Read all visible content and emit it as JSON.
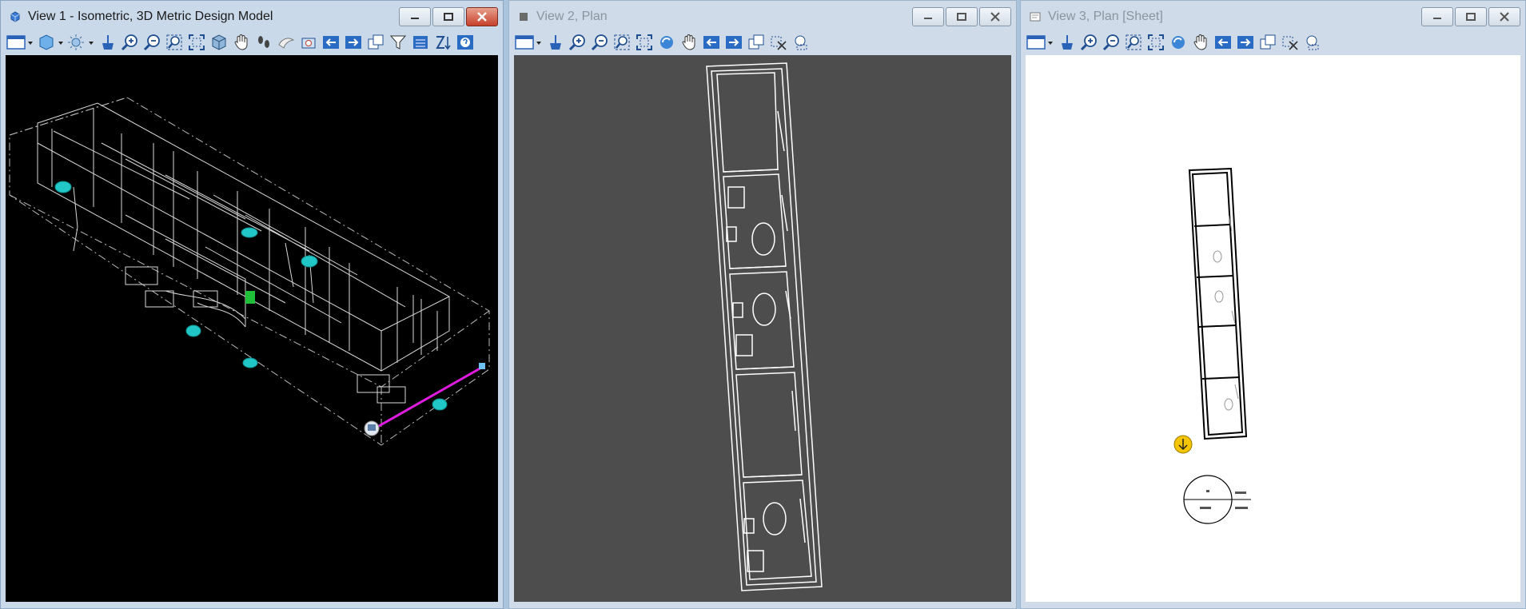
{
  "windows": [
    {
      "title": "View 1 - Isometric, 3D Metric Design Model",
      "state": "active",
      "background": "#000000",
      "toolbar_icons": [
        "view-attributes-icon",
        "display-style-icon",
        "lighting-icon",
        "update-view-icon",
        "zoom-in-icon",
        "zoom-out-icon",
        "window-area-icon",
        "fit-view-icon",
        "rotate-view-icon",
        "pan-icon",
        "walk-icon",
        "fly-icon",
        "camera-icon",
        "previous-view-icon",
        "next-view-icon",
        "copy-view-icon",
        "clip-volume-icon",
        "toggle-3d-icon",
        "sync-view-icon",
        "help-icon"
      ]
    },
    {
      "title": "View 2, Plan",
      "state": "inactive",
      "background": "#4d4d4d",
      "toolbar_icons": [
        "view-attributes-icon",
        "update-view-icon",
        "zoom-in-icon",
        "zoom-out-icon",
        "window-area-icon",
        "fit-view-icon",
        "rotate-view-icon",
        "pan-icon",
        "previous-view-icon",
        "next-view-icon",
        "copy-view-icon",
        "clip-volume-icon",
        "view-extent-icon"
      ]
    },
    {
      "title": "View 3, Plan [Sheet]",
      "state": "inactive",
      "background": "#ffffff",
      "toolbar_icons": [
        "view-attributes-icon",
        "update-view-icon",
        "zoom-in-icon",
        "zoom-out-icon",
        "window-area-icon",
        "fit-view-icon",
        "rotate-view-icon",
        "pan-icon",
        "previous-view-icon",
        "next-view-icon",
        "copy-view-icon",
        "clip-volume-icon",
        "view-extent-icon"
      ]
    }
  ],
  "colors": {
    "accent_cyan": "#21c6c6",
    "measure_line": "#e01be0",
    "plan_lines": "#ffffff",
    "sheet_lines": "#000000",
    "marker": "#f5c400"
  }
}
